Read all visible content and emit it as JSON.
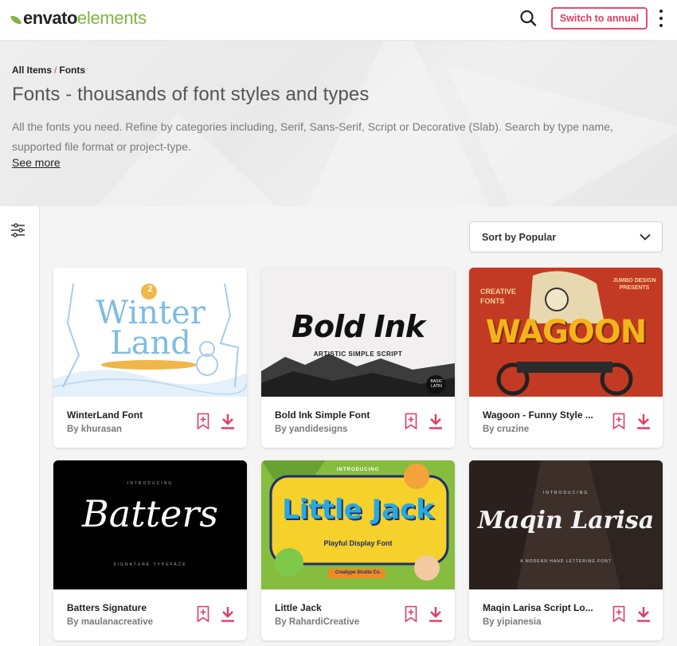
{
  "header": {
    "logo_part1": "envato",
    "logo_part2": "elements",
    "annual_button": "Switch to annual"
  },
  "hero": {
    "breadcrumb_root": "All Items",
    "breadcrumb_sep": "/",
    "breadcrumb_current": "Fonts",
    "title": "Fonts - thousands of font styles and types",
    "description": "All the fonts you need. Refine by categories including, Serif, Sans-Serif, Script or Decorative (Slab). Search by type name, supported file format or project-type.",
    "see_more": "See more"
  },
  "sort": {
    "label": "Sort by Popular"
  },
  "cards": [
    {
      "title": "WinterLand Font",
      "author": "By khurasan",
      "thumb_text": "Winter Land",
      "thumb_badge": "2"
    },
    {
      "title": "Bold Ink Simple Font",
      "author": "By yandidesigns",
      "thumb_text": "Bold Ink",
      "thumb_sub": "ARTISTIC SIMPLE SCRIPT",
      "thumb_badge": "BASIC LATIN"
    },
    {
      "title": "Wagoon - Funny Style ...",
      "author": "By cruzine",
      "thumb_text": "WAGOON",
      "thumb_sub_left": "CREATIVE FONTS",
      "thumb_sub_right": "JUMBO DESIGN PRESENTS"
    },
    {
      "title": "Batters Signature",
      "author": "By maulanacreative",
      "thumb_text": "Batters",
      "thumb_intro": "INTRODUCING",
      "thumb_sub": "SIGNATURE TYPEFACE"
    },
    {
      "title": "Little Jack",
      "author": "By RahardiCreative",
      "thumb_text": "Little Jack",
      "thumb_intro": "INTRODUCING",
      "thumb_sub": "Playful Display Font",
      "thumb_studio": "Creatype Studio Co."
    },
    {
      "title": "Maqin Larisa Script Lo...",
      "author": "By yipianesia",
      "thumb_text": "Maqin Larisa",
      "thumb_intro": "INTRODUCING",
      "thumb_sub": "A MODERN HAND LETTERING FONT"
    }
  ],
  "colors": {
    "accent": "#e03c62",
    "brand_green": "#82b541"
  },
  "icons": {
    "search": "search-icon",
    "more": "more-vertical-icon",
    "filter": "filter-sliders-icon",
    "chevron": "chevron-down-icon",
    "bookmark": "bookmark-add-icon",
    "download": "download-icon"
  }
}
